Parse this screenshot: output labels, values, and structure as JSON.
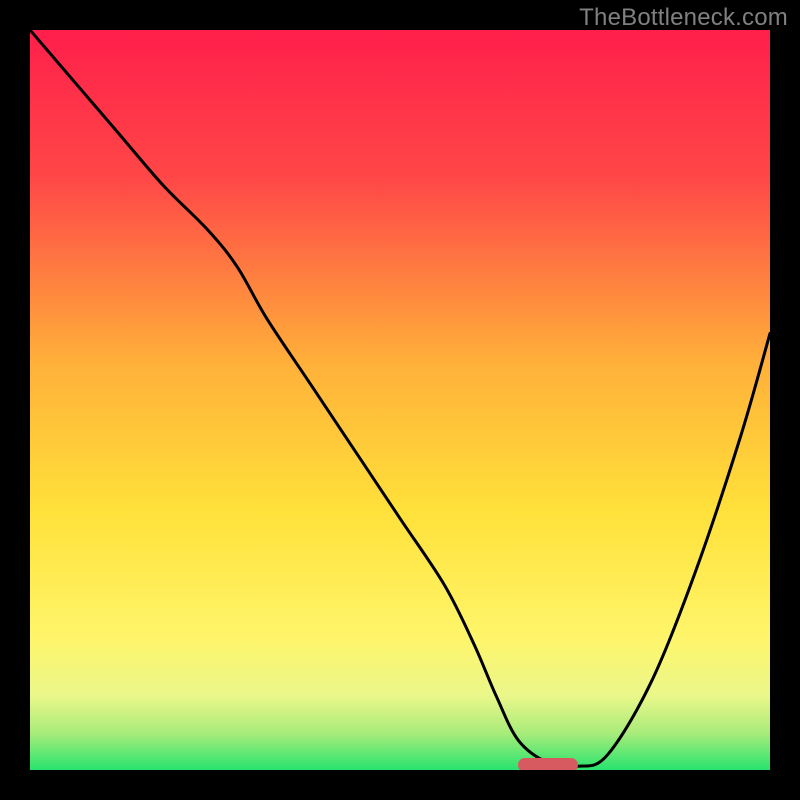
{
  "watermark": "TheBottleneck.com",
  "chart_data": {
    "type": "line",
    "title": "",
    "xlabel": "",
    "ylabel": "",
    "xrange": [
      0,
      100
    ],
    "yrange": [
      0,
      100
    ],
    "gradient_stops": [
      {
        "offset": 0,
        "color": "#ff1f4b"
      },
      {
        "offset": 0.2,
        "color": "#ff4747"
      },
      {
        "offset": 0.45,
        "color": "#ffb03a"
      },
      {
        "offset": 0.65,
        "color": "#ffe13a"
      },
      {
        "offset": 0.82,
        "color": "#fff56a"
      },
      {
        "offset": 0.9,
        "color": "#eaf78a"
      },
      {
        "offset": 0.95,
        "color": "#a9ec7a"
      },
      {
        "offset": 1.0,
        "color": "#27e36e"
      }
    ],
    "series": [
      {
        "name": "bottleneck-curve",
        "x": [
          0,
          6,
          12,
          18,
          24,
          28,
          32,
          38,
          44,
          50,
          56,
          60,
          63,
          66,
          70,
          74,
          78,
          84,
          90,
          96,
          100
        ],
        "y": [
          100,
          93,
          86,
          79,
          73,
          68,
          61,
          52,
          43,
          34,
          25,
          17,
          10,
          4,
          1,
          0.5,
          2,
          12,
          27,
          45,
          59
        ]
      }
    ],
    "marker": {
      "x_start": 66,
      "x_end": 74,
      "y": 0
    },
    "legend": [],
    "annotations": []
  }
}
